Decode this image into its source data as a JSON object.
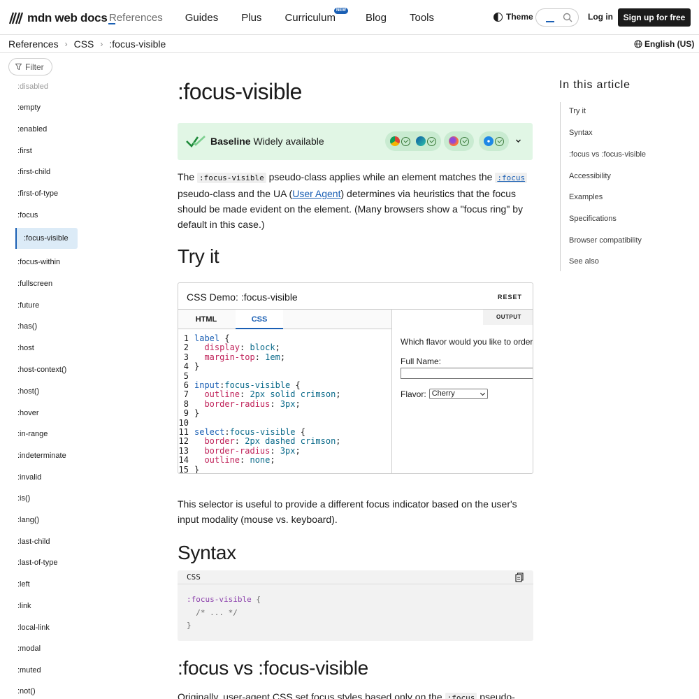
{
  "header": {
    "logo_text": "mdn web docs",
    "nav": [
      {
        "label": "References"
      },
      {
        "label": "Guides"
      },
      {
        "label": "Plus"
      },
      {
        "label": "Curriculum",
        "badge": "NEW"
      },
      {
        "label": "Blog"
      },
      {
        "label": "Tools"
      }
    ],
    "theme_label": "Theme",
    "login_label": "Log in",
    "signup_label": "Sign up for free"
  },
  "breadcrumb": {
    "items": [
      "References",
      "CSS",
      ":focus-visible"
    ],
    "language": "English (US)"
  },
  "sidebar": {
    "filter_label": "Filter",
    "items": [
      ":disabled",
      ":empty",
      ":enabled",
      ":first",
      ":first-child",
      ":first-of-type",
      ":focus",
      ":focus-visible",
      ":focus-within",
      ":fullscreen",
      ":future",
      ":has()",
      ":host",
      ":host-context()",
      ":host()",
      ":hover",
      ":in-range",
      ":indeterminate",
      ":invalid",
      ":is()",
      ":lang()",
      ":last-child",
      ":last-of-type",
      ":left",
      ":link",
      ":local-link",
      ":modal",
      ":muted",
      ":not()"
    ]
  },
  "article": {
    "title": ":focus-visible",
    "baseline": {
      "bold": "Baseline",
      "text": "Widely available"
    },
    "intro": {
      "p1": "The ",
      "code1": ":focus-visible",
      "p2": " pseudo-class applies while an element matches the ",
      "code2": ":focus",
      "p3": " pseudo-class and the UA (",
      "link": "User Agent",
      "p4": ") determines via heuristics that the focus should be made evident on the element. (Many browsers show a \"focus ring\" by default in this case.)"
    },
    "try_it_heading": "Try it",
    "demo": {
      "title": "CSS Demo: :focus-visible",
      "reset_label": "RESET",
      "tab_html": "HTML",
      "tab_css": "CSS",
      "output_label": "OUTPUT",
      "question": "Which flavor would you like to order",
      "full_name_label": "Full Name:",
      "flavor_label": "Flavor:",
      "flavor_value": "Cherry",
      "code": [
        [
          "1",
          "label",
          " {"
        ],
        [
          "2",
          "  display",
          ": ",
          "block",
          ";"
        ],
        [
          "3",
          "  margin-top",
          ": ",
          "1em",
          ";"
        ],
        [
          "4",
          "}"
        ],
        [
          "5",
          ""
        ],
        [
          "6",
          "input:focus-visible",
          " {"
        ],
        [
          "7",
          "  outline",
          ": ",
          "2px solid crimson",
          ";"
        ],
        [
          "8",
          "  border-radius",
          ": ",
          "3px",
          ";"
        ],
        [
          "9",
          "}"
        ],
        [
          "10",
          ""
        ],
        [
          "11",
          "select:focus-visible",
          " {"
        ],
        [
          "12",
          "  border",
          ": ",
          "2px dashed crimson",
          ";"
        ],
        [
          "13",
          "  border-radius",
          ": ",
          "3px",
          ";"
        ],
        [
          "14",
          "  outline",
          ": ",
          "none",
          ";"
        ],
        [
          "15",
          "}"
        ]
      ]
    },
    "selector_para": "This selector is useful to provide a different focus indicator based on the user's input modality (mouse vs. keyboard).",
    "syntax_heading": "Syntax",
    "syntax_block": {
      "lang": "CSS",
      "line1_sel": ":focus-visible",
      "line1_brace": " {",
      "line2": "  /* ... */",
      "line3": "}"
    },
    "focus_vs_heading": ":focus vs :focus-visible",
    "focus_vs_para_start": "Originally, user-agent CSS set focus styles based only on the ",
    "focus_vs_code": ":focus",
    "focus_vs_para_end": " pseudo-class"
  },
  "toc": {
    "title": "In this article",
    "items": [
      "Try it",
      "Syntax",
      ":focus vs :focus-visible",
      "Accessibility",
      "Examples",
      "Specifications",
      "Browser compatibility",
      "See also"
    ]
  },
  "colors": {
    "accent": "#1a5fb4",
    "baseline_bg": "#e1f6e5",
    "active_item_bg": "#dcebf7"
  }
}
